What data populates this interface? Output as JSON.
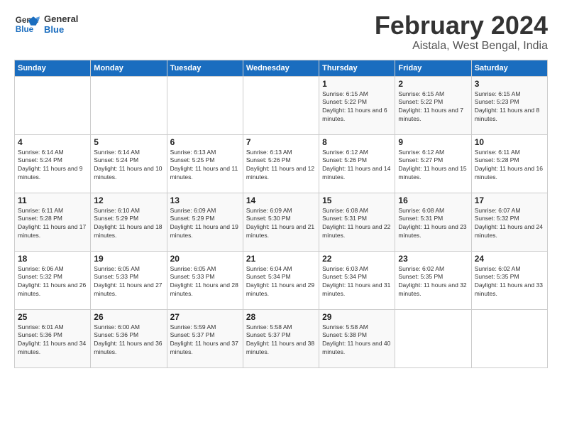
{
  "header": {
    "logo_line1": "General",
    "logo_line2": "Blue",
    "title": "February 2024",
    "subtitle": "Aistala, West Bengal, India"
  },
  "days_of_week": [
    "Sunday",
    "Monday",
    "Tuesday",
    "Wednesday",
    "Thursday",
    "Friday",
    "Saturday"
  ],
  "weeks": [
    [
      {
        "day": "",
        "sunrise": "",
        "sunset": "",
        "daylight": ""
      },
      {
        "day": "",
        "sunrise": "",
        "sunset": "",
        "daylight": ""
      },
      {
        "day": "",
        "sunrise": "",
        "sunset": "",
        "daylight": ""
      },
      {
        "day": "",
        "sunrise": "",
        "sunset": "",
        "daylight": ""
      },
      {
        "day": "1",
        "sunrise": "Sunrise: 6:15 AM",
        "sunset": "Sunset: 5:22 PM",
        "daylight": "Daylight: 11 hours and 6 minutes."
      },
      {
        "day": "2",
        "sunrise": "Sunrise: 6:15 AM",
        "sunset": "Sunset: 5:22 PM",
        "daylight": "Daylight: 11 hours and 7 minutes."
      },
      {
        "day": "3",
        "sunrise": "Sunrise: 6:15 AM",
        "sunset": "Sunset: 5:23 PM",
        "daylight": "Daylight: 11 hours and 8 minutes."
      }
    ],
    [
      {
        "day": "4",
        "sunrise": "Sunrise: 6:14 AM",
        "sunset": "Sunset: 5:24 PM",
        "daylight": "Daylight: 11 hours and 9 minutes."
      },
      {
        "day": "5",
        "sunrise": "Sunrise: 6:14 AM",
        "sunset": "Sunset: 5:24 PM",
        "daylight": "Daylight: 11 hours and 10 minutes."
      },
      {
        "day": "6",
        "sunrise": "Sunrise: 6:13 AM",
        "sunset": "Sunset: 5:25 PM",
        "daylight": "Daylight: 11 hours and 11 minutes."
      },
      {
        "day": "7",
        "sunrise": "Sunrise: 6:13 AM",
        "sunset": "Sunset: 5:26 PM",
        "daylight": "Daylight: 11 hours and 12 minutes."
      },
      {
        "day": "8",
        "sunrise": "Sunrise: 6:12 AM",
        "sunset": "Sunset: 5:26 PM",
        "daylight": "Daylight: 11 hours and 14 minutes."
      },
      {
        "day": "9",
        "sunrise": "Sunrise: 6:12 AM",
        "sunset": "Sunset: 5:27 PM",
        "daylight": "Daylight: 11 hours and 15 minutes."
      },
      {
        "day": "10",
        "sunrise": "Sunrise: 6:11 AM",
        "sunset": "Sunset: 5:28 PM",
        "daylight": "Daylight: 11 hours and 16 minutes."
      }
    ],
    [
      {
        "day": "11",
        "sunrise": "Sunrise: 6:11 AM",
        "sunset": "Sunset: 5:28 PM",
        "daylight": "Daylight: 11 hours and 17 minutes."
      },
      {
        "day": "12",
        "sunrise": "Sunrise: 6:10 AM",
        "sunset": "Sunset: 5:29 PM",
        "daylight": "Daylight: 11 hours and 18 minutes."
      },
      {
        "day": "13",
        "sunrise": "Sunrise: 6:09 AM",
        "sunset": "Sunset: 5:29 PM",
        "daylight": "Daylight: 11 hours and 19 minutes."
      },
      {
        "day": "14",
        "sunrise": "Sunrise: 6:09 AM",
        "sunset": "Sunset: 5:30 PM",
        "daylight": "Daylight: 11 hours and 21 minutes."
      },
      {
        "day": "15",
        "sunrise": "Sunrise: 6:08 AM",
        "sunset": "Sunset: 5:31 PM",
        "daylight": "Daylight: 11 hours and 22 minutes."
      },
      {
        "day": "16",
        "sunrise": "Sunrise: 6:08 AM",
        "sunset": "Sunset: 5:31 PM",
        "daylight": "Daylight: 11 hours and 23 minutes."
      },
      {
        "day": "17",
        "sunrise": "Sunrise: 6:07 AM",
        "sunset": "Sunset: 5:32 PM",
        "daylight": "Daylight: 11 hours and 24 minutes."
      }
    ],
    [
      {
        "day": "18",
        "sunrise": "Sunrise: 6:06 AM",
        "sunset": "Sunset: 5:32 PM",
        "daylight": "Daylight: 11 hours and 26 minutes."
      },
      {
        "day": "19",
        "sunrise": "Sunrise: 6:05 AM",
        "sunset": "Sunset: 5:33 PM",
        "daylight": "Daylight: 11 hours and 27 minutes."
      },
      {
        "day": "20",
        "sunrise": "Sunrise: 6:05 AM",
        "sunset": "Sunset: 5:33 PM",
        "daylight": "Daylight: 11 hours and 28 minutes."
      },
      {
        "day": "21",
        "sunrise": "Sunrise: 6:04 AM",
        "sunset": "Sunset: 5:34 PM",
        "daylight": "Daylight: 11 hours and 29 minutes."
      },
      {
        "day": "22",
        "sunrise": "Sunrise: 6:03 AM",
        "sunset": "Sunset: 5:34 PM",
        "daylight": "Daylight: 11 hours and 31 minutes."
      },
      {
        "day": "23",
        "sunrise": "Sunrise: 6:02 AM",
        "sunset": "Sunset: 5:35 PM",
        "daylight": "Daylight: 11 hours and 32 minutes."
      },
      {
        "day": "24",
        "sunrise": "Sunrise: 6:02 AM",
        "sunset": "Sunset: 5:35 PM",
        "daylight": "Daylight: 11 hours and 33 minutes."
      }
    ],
    [
      {
        "day": "25",
        "sunrise": "Sunrise: 6:01 AM",
        "sunset": "Sunset: 5:36 PM",
        "daylight": "Daylight: 11 hours and 34 minutes."
      },
      {
        "day": "26",
        "sunrise": "Sunrise: 6:00 AM",
        "sunset": "Sunset: 5:36 PM",
        "daylight": "Daylight: 11 hours and 36 minutes."
      },
      {
        "day": "27",
        "sunrise": "Sunrise: 5:59 AM",
        "sunset": "Sunset: 5:37 PM",
        "daylight": "Daylight: 11 hours and 37 minutes."
      },
      {
        "day": "28",
        "sunrise": "Sunrise: 5:58 AM",
        "sunset": "Sunset: 5:37 PM",
        "daylight": "Daylight: 11 hours and 38 minutes."
      },
      {
        "day": "29",
        "sunrise": "Sunrise: 5:58 AM",
        "sunset": "Sunset: 5:38 PM",
        "daylight": "Daylight: 11 hours and 40 minutes."
      },
      {
        "day": "",
        "sunrise": "",
        "sunset": "",
        "daylight": ""
      },
      {
        "day": "",
        "sunrise": "",
        "sunset": "",
        "daylight": ""
      }
    ]
  ]
}
